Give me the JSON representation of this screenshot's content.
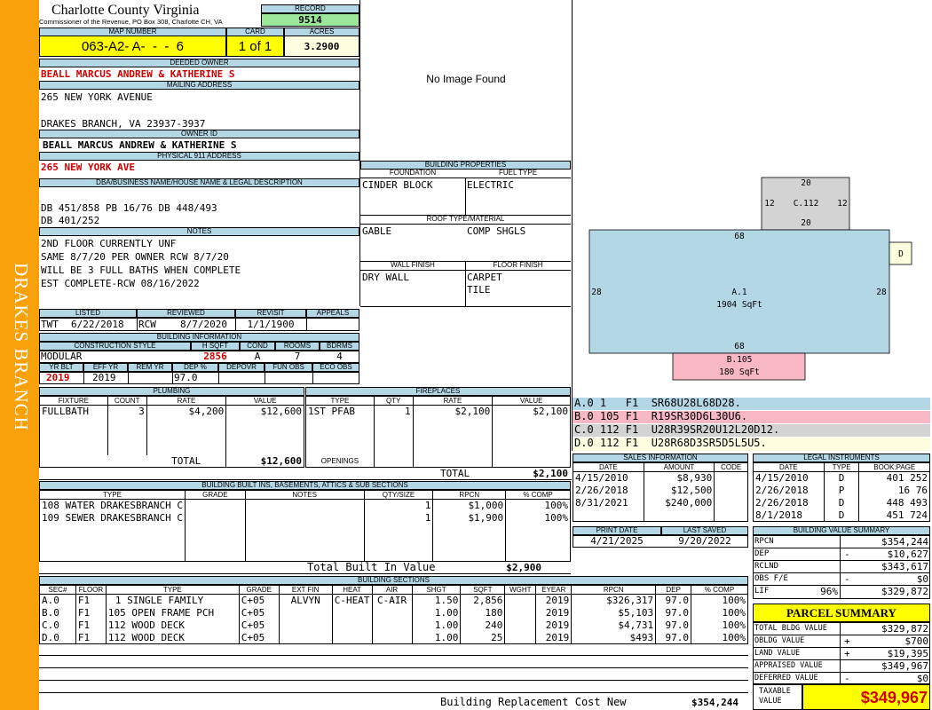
{
  "side_label": "DRAKES BRANCH",
  "header": {
    "county": "Charlotte County Virginia",
    "commissioner": "Commissioner of the Revenue, PO Box 308, Charlotte CH, VA",
    "record_label": "RECORD",
    "record": "9514",
    "map_number_label": "MAP NUMBER",
    "map_number": "063-A2- A-  -  -  6",
    "card_label": "CARD",
    "card": "1 of 1",
    "acres_label": "ACRES",
    "acres": "3.2900"
  },
  "owner": {
    "deeded_owner_label": "DEEDED OWNER",
    "deeded_owner": "BEALL MARCUS ANDREW & KATHERINE S",
    "mailing_address_label": "MAILING ADDRESS",
    "mailing_line1": "265 NEW YORK AVENUE",
    "mailing_line2": "DRAKES BRANCH, VA 23937-3937",
    "owner_id_label": "OWNER ID",
    "owner_id": "BEALL MARCUS ANDREW & KATHERINE S",
    "physical_address_label": "PHYSICAL 911 ADDRESS",
    "physical_address": "265 NEW YORK AVE",
    "dba_label": "DBA/BUSINESS NAME/HOUSE NAME & LEGAL DESCRIPTION",
    "legal_line1": "DB 451/858 PB 16/76 DB 448/493",
    "legal_line2": "DB 401/252"
  },
  "notes": {
    "label": "NOTES",
    "lines": [
      "2ND FLOOR CURRENTLY UNF",
      "SAME 8/7/20 PER OWNER RCW 8/7/20",
      "WILL BE 3 FULL BATHS WHEN COMPLETE",
      "EST COMPLETE-RCW 08/16/2022"
    ]
  },
  "review": {
    "listed_label": "LISTED",
    "listed_by": "TWT",
    "listed_date": "6/22/2018",
    "reviewed_label": "REVIEWED",
    "reviewed_by": "RCW",
    "reviewed_date": "8/7/2020",
    "revisit_label": "REVISIT",
    "revisit": "1/1/1900",
    "appeals_label": "APPEALS",
    "appeals": ""
  },
  "building_info": {
    "label": "BUILDING INFORMATION",
    "construction_label": "CONSTRUCTION STYLE",
    "construction": "MODULAR",
    "hsqft_label": "H SQFT",
    "hsqft": "2856",
    "cond_label": "COND",
    "cond": "A",
    "rooms_label": "ROOMS",
    "rooms": "7",
    "bdrms_label": "BDRMS",
    "bdrms": "4",
    "yrblt_label": "YR BLT",
    "yrblt": "2019",
    "effyr_label": "EFF YR",
    "effyr": "2019",
    "remyr_label": "REM YR",
    "remyr": "",
    "dep_label": "DEP %",
    "dep": "97.0",
    "depovr_label": "DEPOVR",
    "depovr": "",
    "funobs_label": "FUN OBS",
    "funobs": "",
    "ecoobs_label": "ECO OBS",
    "ecoobs": ""
  },
  "image_placeholder": "No Image Found",
  "building_properties": {
    "label": "BUILDING PROPERTIES",
    "foundation_label": "FOUNDATION",
    "foundation": "CINDER BLOCK",
    "fuel_label": "FUEL TYPE",
    "fuel": "ELECTRIC",
    "roof_label": "ROOF TYPE/MATERIAL",
    "roof_type": "GABLE",
    "roof_material": "COMP SHGLS",
    "wall_label": "WALL FINISH",
    "wall": "DRY WALL",
    "floor_label": "FLOOR FINISH",
    "floor1": "CARPET",
    "floor2": "TILE"
  },
  "sketch": {
    "a_top": "68",
    "a_bottom": "68",
    "a_left": "28",
    "a_right": "28",
    "a_name": "A.1",
    "a_area": "1904 SqFt",
    "c_top": "20",
    "c_bottom": "20",
    "c_left": "12",
    "c_right": "12",
    "c_name": "C.112",
    "b_name": "B.105",
    "b_area": "180 SqFt",
    "d_name": "D"
  },
  "sketch_codes": [
    {
      "code": "A.0 1   F1  SR68U28L68D28.",
      "color": "#b4d7e6"
    },
    {
      "code": "B.0 105 F1  R19SR30D6L30U6.",
      "color": "#f8b7c4"
    },
    {
      "code": "C.0 112 F1  U28R39SR20U12L20D12.",
      "color": "#d3d3d3"
    },
    {
      "code": "D.0 112 F1  U28R68D3SR5D5L5U5.",
      "color": "#fdfde0"
    }
  ],
  "plumbing": {
    "label": "PLUMBING",
    "cols": [
      "FIXTURE",
      "COUNT",
      "RATE",
      "VALUE"
    ],
    "rows": [
      [
        "FULLBATH",
        "3",
        "$4,200",
        "$12,600"
      ]
    ],
    "total_label": "TOTAL",
    "total": "$12,600"
  },
  "fireplaces": {
    "label": "FIREPLACES",
    "cols": [
      "TYPE",
      "QTY",
      "RATE",
      "VALUE"
    ],
    "rows": [
      [
        "1ST PFAB",
        "1",
        "$2,100",
        "$2,100"
      ]
    ],
    "openings_label": "OPENINGS",
    "total_label": "TOTAL",
    "total": "$2,100"
  },
  "sales": {
    "label": "SALES INFORMATION",
    "cols": [
      "DATE",
      "AMOUNT",
      "CODE"
    ],
    "rows": [
      [
        "4/15/2010",
        "$8,930",
        ""
      ],
      [
        "2/26/2018",
        "$12,500",
        ""
      ],
      [
        "8/31/2021",
        "$240,000",
        ""
      ]
    ]
  },
  "legal_instruments": {
    "label": "LEGAL INSTRUMENTS",
    "cols": [
      "DATE",
      "TYPE",
      "BOOK:PAGE"
    ],
    "rows": [
      [
        "4/15/2010",
        "D",
        "401 252"
      ],
      [
        "2/26/2018",
        "P",
        "16 76"
      ],
      [
        "2/26/2018",
        "D",
        "448 493"
      ],
      [
        "8/1/2018",
        "D",
        "451 724"
      ]
    ]
  },
  "builtins": {
    "label": "BUILDING BUILT INS, BASEMENTS, ATTICS & SUB SECTIONS",
    "cols": [
      "TYPE",
      "GRADE",
      "NOTES",
      "QTY/SIZE",
      "RPCN",
      "% COMP"
    ],
    "rows": [
      [
        "108 WATER DRAKESBRANCH C",
        "",
        "",
        "1",
        "$1,000",
        "100%"
      ],
      [
        "109 SEWER DRAKESBRANCH C",
        "",
        "",
        "1",
        "$1,900",
        "100%"
      ]
    ],
    "total_label": "Total Built In Value",
    "total": "$2,900"
  },
  "print_info": {
    "print_label": "PRINT DATE",
    "print_date": "4/21/2025",
    "saved_label": "LAST SAVED",
    "saved_date": "9/20/2022"
  },
  "value_summary": {
    "label": "BUILDING VALUE SUMMARY",
    "rows": [
      {
        "label": "RPCN",
        "sign": "",
        "value": "$354,244"
      },
      {
        "label": "DEP",
        "sign": "-",
        "value": "$10,627"
      },
      {
        "label": "RCLND",
        "sign": "",
        "value": "$343,617"
      },
      {
        "label": "OBS F/E",
        "sign": "-",
        "value": "$0"
      },
      {
        "label": "LIF",
        "pct": "96%",
        "sign": "",
        "value": "$329,872"
      }
    ]
  },
  "parcel_summary": {
    "label": "PARCEL SUMMARY",
    "rows": [
      {
        "label": "TOTAL BLDG VALUE",
        "sign": "",
        "value": "$329,872"
      },
      {
        "label": "OBLDG VALUE",
        "sign": "+",
        "value": "$700"
      },
      {
        "label": "LAND VALUE",
        "sign": "+",
        "value": "$19,395"
      },
      {
        "label": "APPRAISED VALUE",
        "sign": "",
        "value": "$349,967"
      },
      {
        "label": "DEFERRED VALUE",
        "sign": "-",
        "value": "$0"
      }
    ],
    "taxable_label": "TAXABLE VALUE",
    "taxable": "$349,967"
  },
  "sections": {
    "label": "BUILDING SECTIONS",
    "cols": [
      "SEC#",
      "FLOOR",
      "TYPE",
      "GRADE",
      "EXT FIN",
      "HEAT",
      "AIR",
      "SHGT",
      "SQFT",
      "WGHT",
      "EYEAR",
      "RPCN",
      "DEP",
      "% COMP"
    ],
    "rows": [
      [
        "A.0",
        "F1",
        "1 SINGLE FAMILY",
        "C+05",
        "ALVYN",
        "C-HEAT",
        "C-AIR",
        "1.50",
        "2,856",
        "",
        "2019",
        "$326,317",
        "97.0",
        "100%"
      ],
      [
        "B.0",
        "F1",
        "105 OPEN FRAME PCH",
        "C+05",
        "",
        "",
        "",
        "1.00",
        "180",
        "",
        "2019",
        "$5,103",
        "97.0",
        "100%"
      ],
      [
        "C.0",
        "F1",
        "112 WOOD DECK",
        "C+05",
        "",
        "",
        "",
        "1.00",
        "240",
        "",
        "2019",
        "$4,731",
        "97.0",
        "100%"
      ],
      [
        "D.0",
        "F1",
        "112 WOOD DECK",
        "C+05",
        "",
        "",
        "",
        "1.00",
        "25",
        "",
        "2019",
        "$493",
        "97.0",
        "100%"
      ]
    ],
    "total_label": "Building Replacement Cost New",
    "total": "$354,244"
  }
}
